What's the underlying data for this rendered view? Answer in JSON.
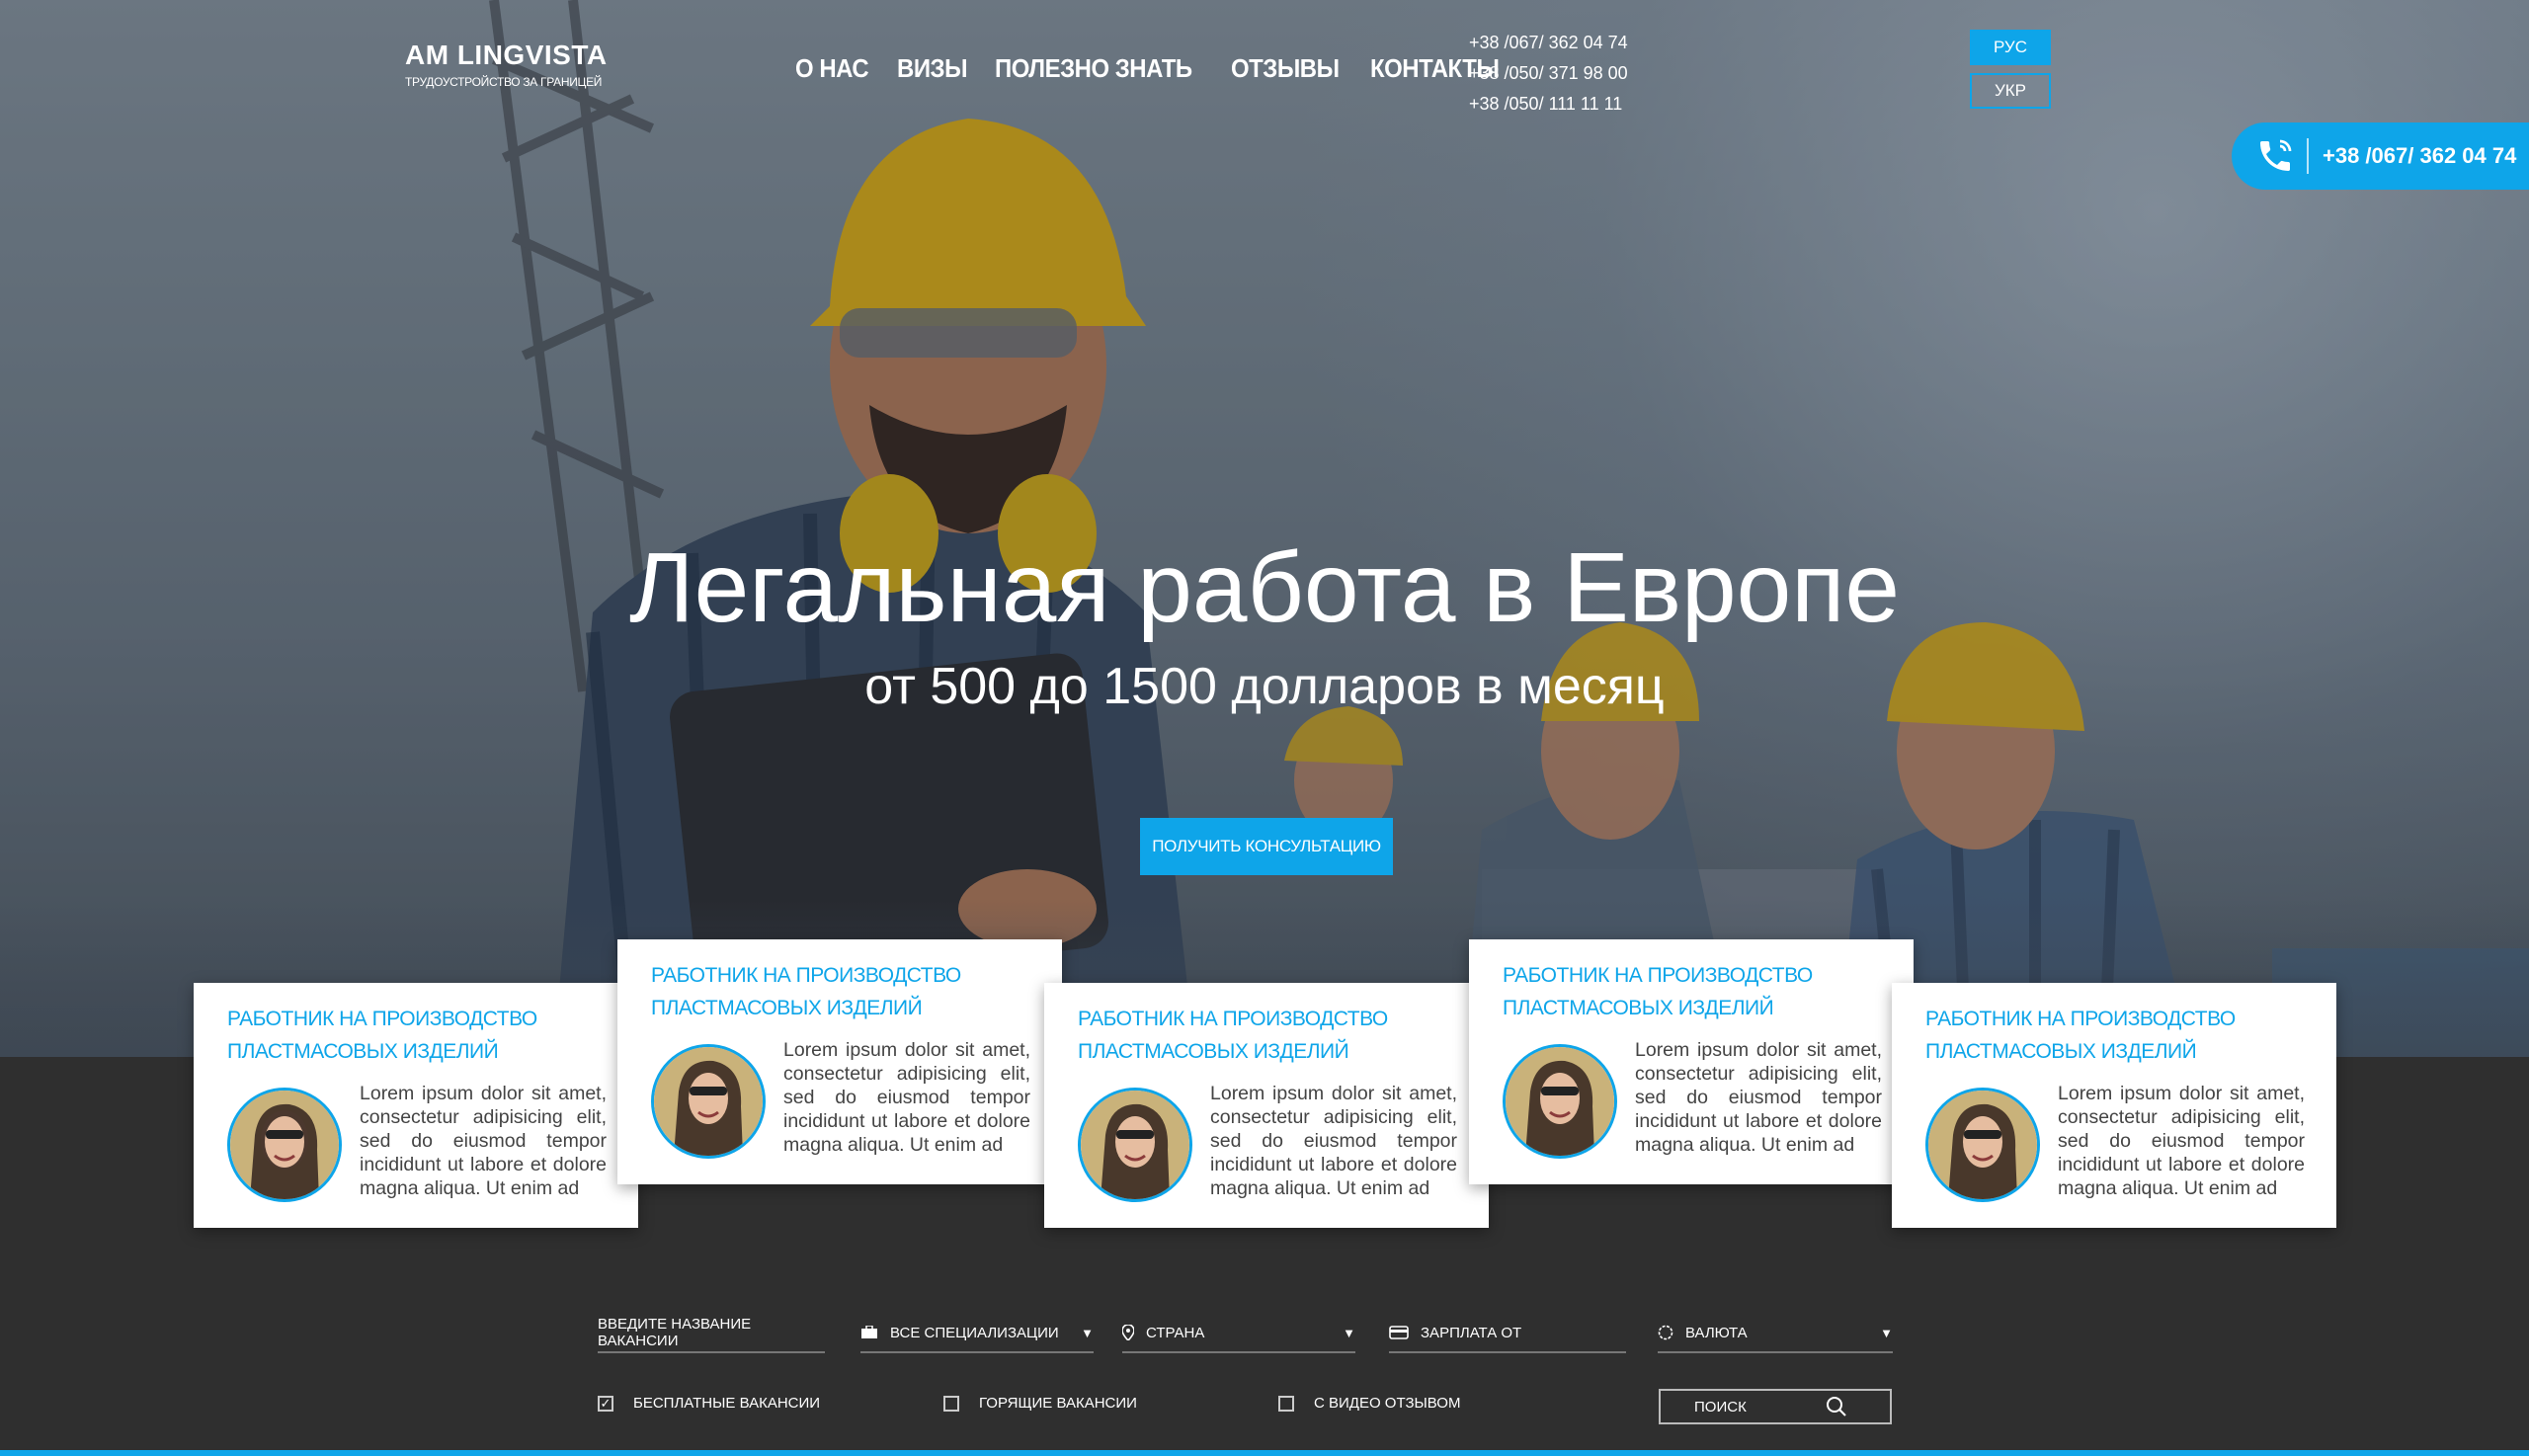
{
  "header": {
    "logo_name": "AM LINGVISTA",
    "logo_tagline": "ТРУДОУСТРОЙСТВО ЗА ГРАНИЦЕЙ",
    "nav": [
      "О НАС",
      "ВИЗЫ",
      "ПОЛЕЗНО ЗНАТЬ",
      "ОТЗЫВЫ",
      "КОНТАКТЫ"
    ],
    "phones": [
      "+38 /067/ 362 04 74",
      "+38 /050/ 371 98 00",
      "+38 /050/ 111 11 11"
    ],
    "languages": [
      "РУС",
      "УКР"
    ],
    "active_language": "РУС",
    "callback_phone": "+38 /067/ 362 04 74"
  },
  "hero": {
    "title": "Легальная работа в Европе",
    "subtitle": "от 500 до 1500 долларов в месяц",
    "cta_label": "ПОЛУЧИТЬ КОНСУЛЬТАЦИЮ"
  },
  "cards": [
    {
      "title": "РАБОТНИК НА ПРОИЗВОДСТВО ПЛАСТМАСОВЫХ ИЗДЕЛИЙ",
      "text": "Lorem ipsum dolor sit amet, consectetur adipisicing elit, sed do eiusmod tempor incididunt ut labore et dolore magna aliqua. Ut enim ad"
    },
    {
      "title": "РАБОТНИК НА ПРОИЗВОДСТВО ПЛАСТМАСОВЫХ ИЗДЕЛИЙ",
      "text": "Lorem ipsum dolor sit amet, consectetur adipisicing elit, sed do eiusmod tempor incididunt ut labore et dolore magna aliqua. Ut enim ad"
    },
    {
      "title": "РАБОТНИК НА ПРОИЗВОДСТВО ПЛАСТМАСОВЫХ ИЗДЕЛИЙ",
      "text": "Lorem ipsum dolor sit amet, consectetur adipisicing elit, sed do eiusmod tempor incididunt ut labore et dolore magna aliqua. Ut enim ad"
    },
    {
      "title": "РАБОТНИК НА ПРОИЗВОДСТВО ПЛАСТМАСОВЫХ ИЗДЕЛИЙ",
      "text": "Lorem ipsum dolor sit amet, consectetur adipisicing elit, sed do eiusmod tempor incididunt ut labore et dolore magna aliqua. Ut enim ad"
    },
    {
      "title": "РАБОТНИК НА ПРОИЗВОДСТВО ПЛАСТМАСОВЫХ ИЗДЕЛИЙ",
      "text": "Lorem ipsum dolor sit amet, consectetur adipisicing elit, sed do eiusmod tempor incididunt ut labore et dolore magna aliqua. Ut enim ad"
    }
  ],
  "filter": {
    "vacancy_placeholder": "ВВЕДИТЕ НАЗВАНИЕ ВАКАНСИИ",
    "specialization": "ВСЕ СПЕЦИАЛИЗАЦИИ",
    "country": "СТРАНА",
    "salary": "ЗАРПЛАТА ОТ",
    "currency": "ВАЛЮТА",
    "checkboxes": [
      {
        "label": "БЕСПЛАТНЫЕ ВАКАНСИИ",
        "checked": true
      },
      {
        "label": "ГОРЯЩИЕ ВАКАНСИИ",
        "checked": false
      },
      {
        "label": "С ВИДЕО ОТЗЫВОМ",
        "checked": false
      }
    ],
    "search_label": "ПОИСК"
  },
  "colors": {
    "accent": "#0ea5e9",
    "dark": "#2f2f2f"
  },
  "icons": {
    "callback": "phone-icon",
    "specialization": "briefcase-icon",
    "country": "location-pin-icon",
    "salary": "wallet-icon",
    "currency": "coin-icon",
    "search": "search-icon",
    "checkbox": "check-icon"
  }
}
